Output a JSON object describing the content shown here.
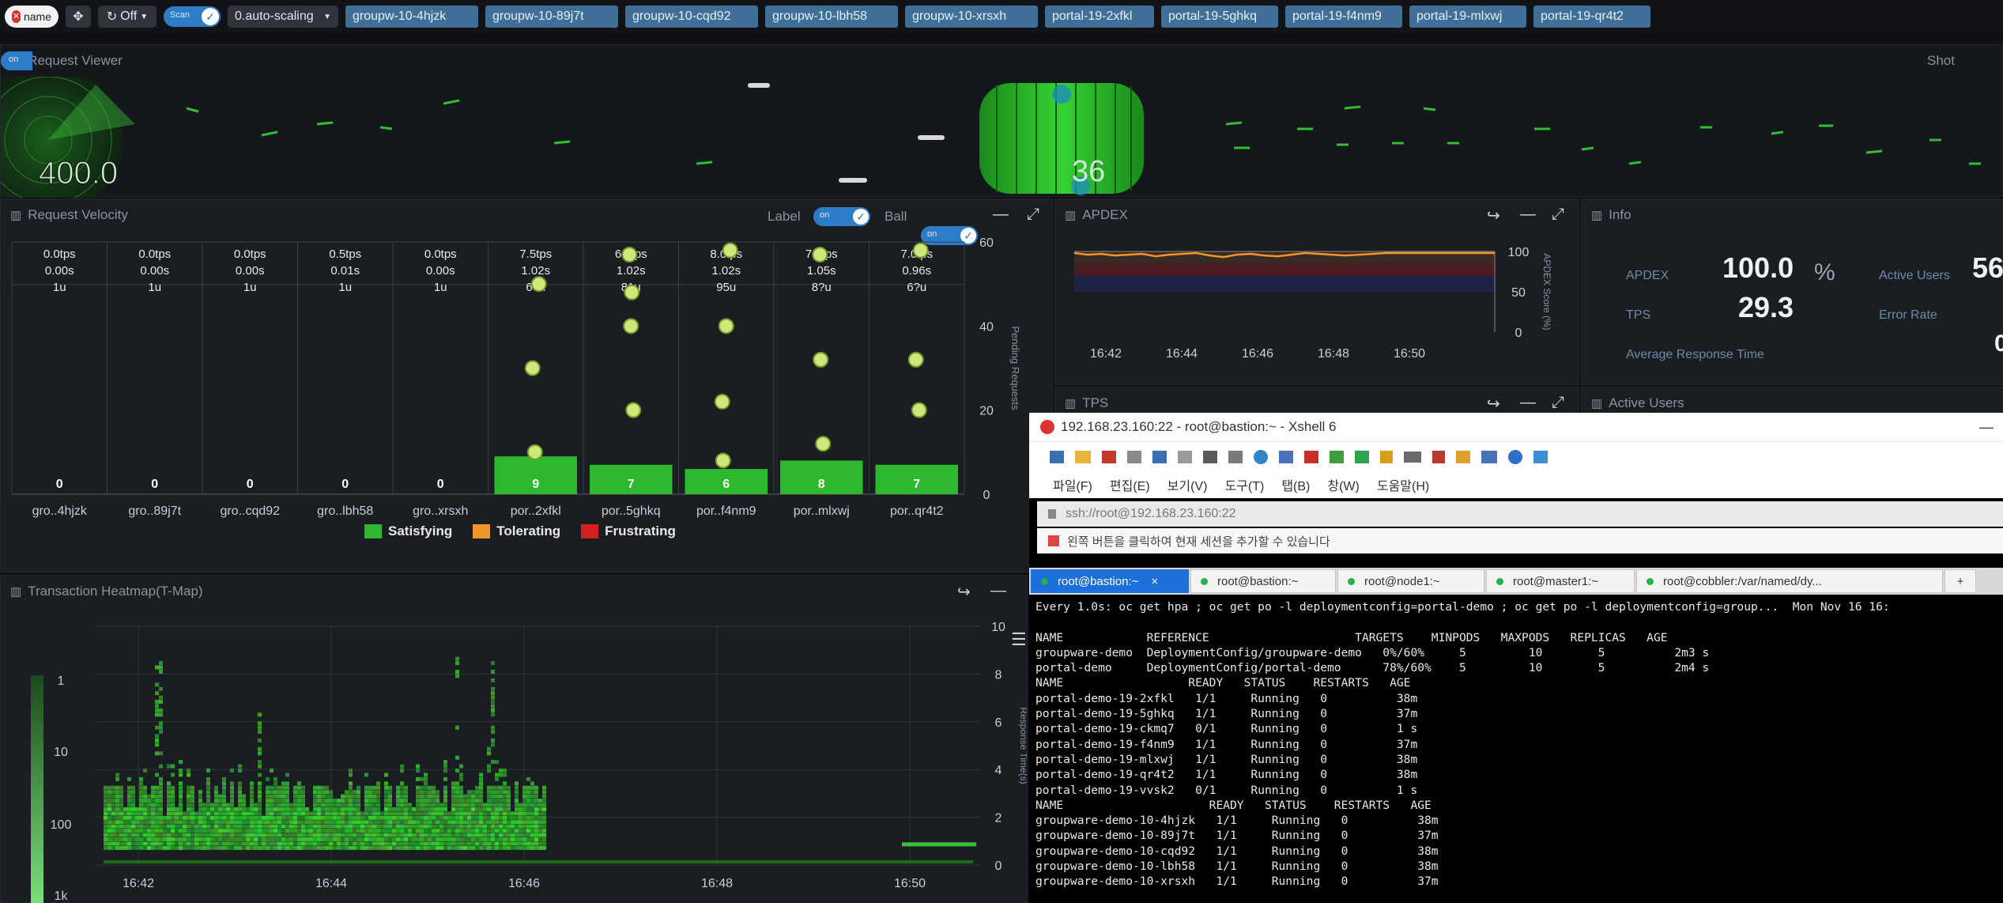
{
  "toolbar": {
    "name_chip": "name",
    "off_label": "Off",
    "scan_label": "Scan",
    "group_select": "0.auto-scaling",
    "chips": [
      "groupw-10-4hjzk",
      "groupw-10-89j7t",
      "groupw-10-cqd92",
      "groupw-10-lbh58",
      "groupw-10-xrsxh",
      "portal-19-2xfkl",
      "portal-19-5ghkq",
      "portal-19-f4nm9",
      "portal-19-mlxwj",
      "portal-19-qr4t2"
    ]
  },
  "request_viewer": {
    "title": "Request Viewer",
    "shot_label": "Shot",
    "toggle_label": "on",
    "left_value": "400.0",
    "right_value": "36"
  },
  "velocity": {
    "title": "Request Velocity",
    "label_toggle": "Label",
    "ball_toggle": "Ball",
    "toggle_on": "on",
    "right_axis_title": "Pending Requests",
    "legend": [
      "Satisfying",
      "Tolerating",
      "Frustrating"
    ]
  },
  "apdex_panel": {
    "title": "APDEX",
    "right_axis_title": "APDEX Score (%)"
  },
  "info": {
    "title": "Info",
    "apdex_label": "APDEX",
    "apdex_value": "100.0",
    "apdex_unit": "%",
    "tps_label": "TPS",
    "tps_value": "29.3",
    "active_users_label": "Active Users",
    "active_users_value": "56",
    "error_rate_label": "Error Rate",
    "error_rate_value": "0",
    "avg_resp_label": "Average Response Time"
  },
  "hidden_titles": {
    "tps": "TPS",
    "active_users": "Active Users"
  },
  "heatmap": {
    "title": "Transaction Heatmap(T-Map)",
    "right_axis_title": "Response Time(s)",
    "left_ticks": [
      "1",
      "10",
      "100",
      "1k"
    ]
  },
  "terminal": {
    "title": "192.168.23.160:22 - root@bastion:~ - Xshell 6",
    "menu": [
      "파일(F)",
      "편집(E)",
      "보기(V)",
      "도구(T)",
      "탭(B)",
      "창(W)",
      "도움말(H)"
    ],
    "address": "ssh://root@192.168.23.160:22",
    "hint": "왼쪽 버튼을 클릭하여 현재 세션을 추가할 수 있습니다",
    "tabs": [
      "root@bastion:~",
      "root@bastion:~",
      "root@node1:~",
      "root@master1:~",
      "root@cobbler:/var/named/dy...",
      "+"
    ],
    "lines": [
      "Every 1.0s: oc get hpa ; oc get po -l deploymentconfig=portal-demo ; oc get po -l deploymentconfig=group...  Mon Nov 16 16:",
      "",
      "NAME            REFERENCE                     TARGETS    MINPODS   MAXPODS   REPLICAS   AGE",
      "groupware-demo  DeploymentConfig/groupware-demo   0%/60%     5         10        5          2m3 s",
      "portal-demo     DeploymentConfig/portal-demo      78%/60%    5         10        5          2m4 s",
      "NAME                  READY   STATUS    RESTARTS   AGE",
      "portal-demo-19-2xfkl   1/1     Running   0          38m",
      "portal-demo-19-5ghkq   1/1     Running   0          37m",
      "portal-demo-19-ckmq7   0/1     Running   0          1 s",
      "portal-demo-19-f4nm9   1/1     Running   0          37m",
      "portal-demo-19-mlxwj   1/1     Running   0          38m",
      "portal-demo-19-qr4t2   1/1     Running   0          38m",
      "portal-demo-19-vvsk2   0/1     Running   0          1 s",
      "NAME                     READY   STATUS    RESTARTS   AGE",
      "groupware-demo-10-4hjzk   1/1     Running   0          38m",
      "groupware-demo-10-89j7t   1/1     Running   0          37m",
      "groupware-demo-10-cqd92   1/1     Running   0          38m",
      "groupware-demo-10-lbh58   1/1     Running   0          38m",
      "groupware-demo-10-xrsxh   1/1     Running   0          37m"
    ]
  },
  "chart_data": [
    {
      "type": "bar",
      "title": "Request Velocity",
      "categories": [
        "gro..4hjzk",
        "gro..89j7t",
        "gro..cqd92",
        "gro..lbh58",
        "gro..xrsxh",
        "por..2xfkl",
        "por..5ghkq",
        "por..f4nm9",
        "por..mlxwj",
        "por..qr4t2"
      ],
      "tps": [
        "0.0tps",
        "0.0tps",
        "0.0tps",
        "0.5tps",
        "0.0tps",
        "7.5tps",
        "6.0tps",
        "8.0tps",
        "7.0tps",
        "7.0tps"
      ],
      "resp": [
        "0.00s",
        "0.00s",
        "0.00s",
        "0.01s",
        "0.00s",
        "1.02s",
        "1.02s",
        "1.02s",
        "1.05s",
        "0.96s"
      ],
      "users": [
        "1u",
        "1u",
        "1u",
        "1u",
        "1u",
        "66u",
        "81u",
        "95u",
        "8?u",
        "6?u"
      ],
      "values": [
        0,
        0,
        0,
        0,
        0,
        9,
        7,
        6,
        8,
        7
      ],
      "ylim": [
        0,
        60
      ],
      "yticks": [
        0,
        20,
        40,
        60
      ],
      "ylabel": "Pending Requests",
      "series": [
        {
          "name": "Satisfying",
          "color": "#2eb82e"
        },
        {
          "name": "Tolerating",
          "color": "#f0962a"
        },
        {
          "name": "Frustrating",
          "color": "#d62020"
        }
      ],
      "legend_position": "bottom"
    },
    {
      "type": "line",
      "title": "APDEX",
      "xticks": [
        "16:42",
        "16:44",
        "16:46",
        "16:48",
        "16:50"
      ],
      "yticks": [
        0,
        50,
        100
      ],
      "ylim": [
        0,
        100
      ],
      "ylabel": "APDEX Score (%)",
      "series": [
        {
          "color": "#f0962a",
          "values": [
            98,
            96,
            97,
            95,
            96,
            97,
            94,
            96,
            97,
            98,
            95,
            93,
            96,
            97,
            95,
            94,
            96,
            98,
            97,
            96,
            95,
            96,
            97,
            98,
            98,
            98,
            98,
            98,
            98,
            98,
            98,
            98
          ]
        }
      ]
    },
    {
      "type": "heatmap",
      "title": "Transaction Heatmap(T-Map)",
      "xticks": [
        "16:42",
        "16:44",
        "16:46",
        "16:48",
        "16:50"
      ],
      "yticks": [
        0,
        2,
        4,
        6,
        8,
        10
      ],
      "ylim": [
        0,
        10
      ],
      "ylabel": "Response Time(s)",
      "left_ticks": [
        "1",
        "10",
        "100",
        "1k"
      ]
    }
  ]
}
